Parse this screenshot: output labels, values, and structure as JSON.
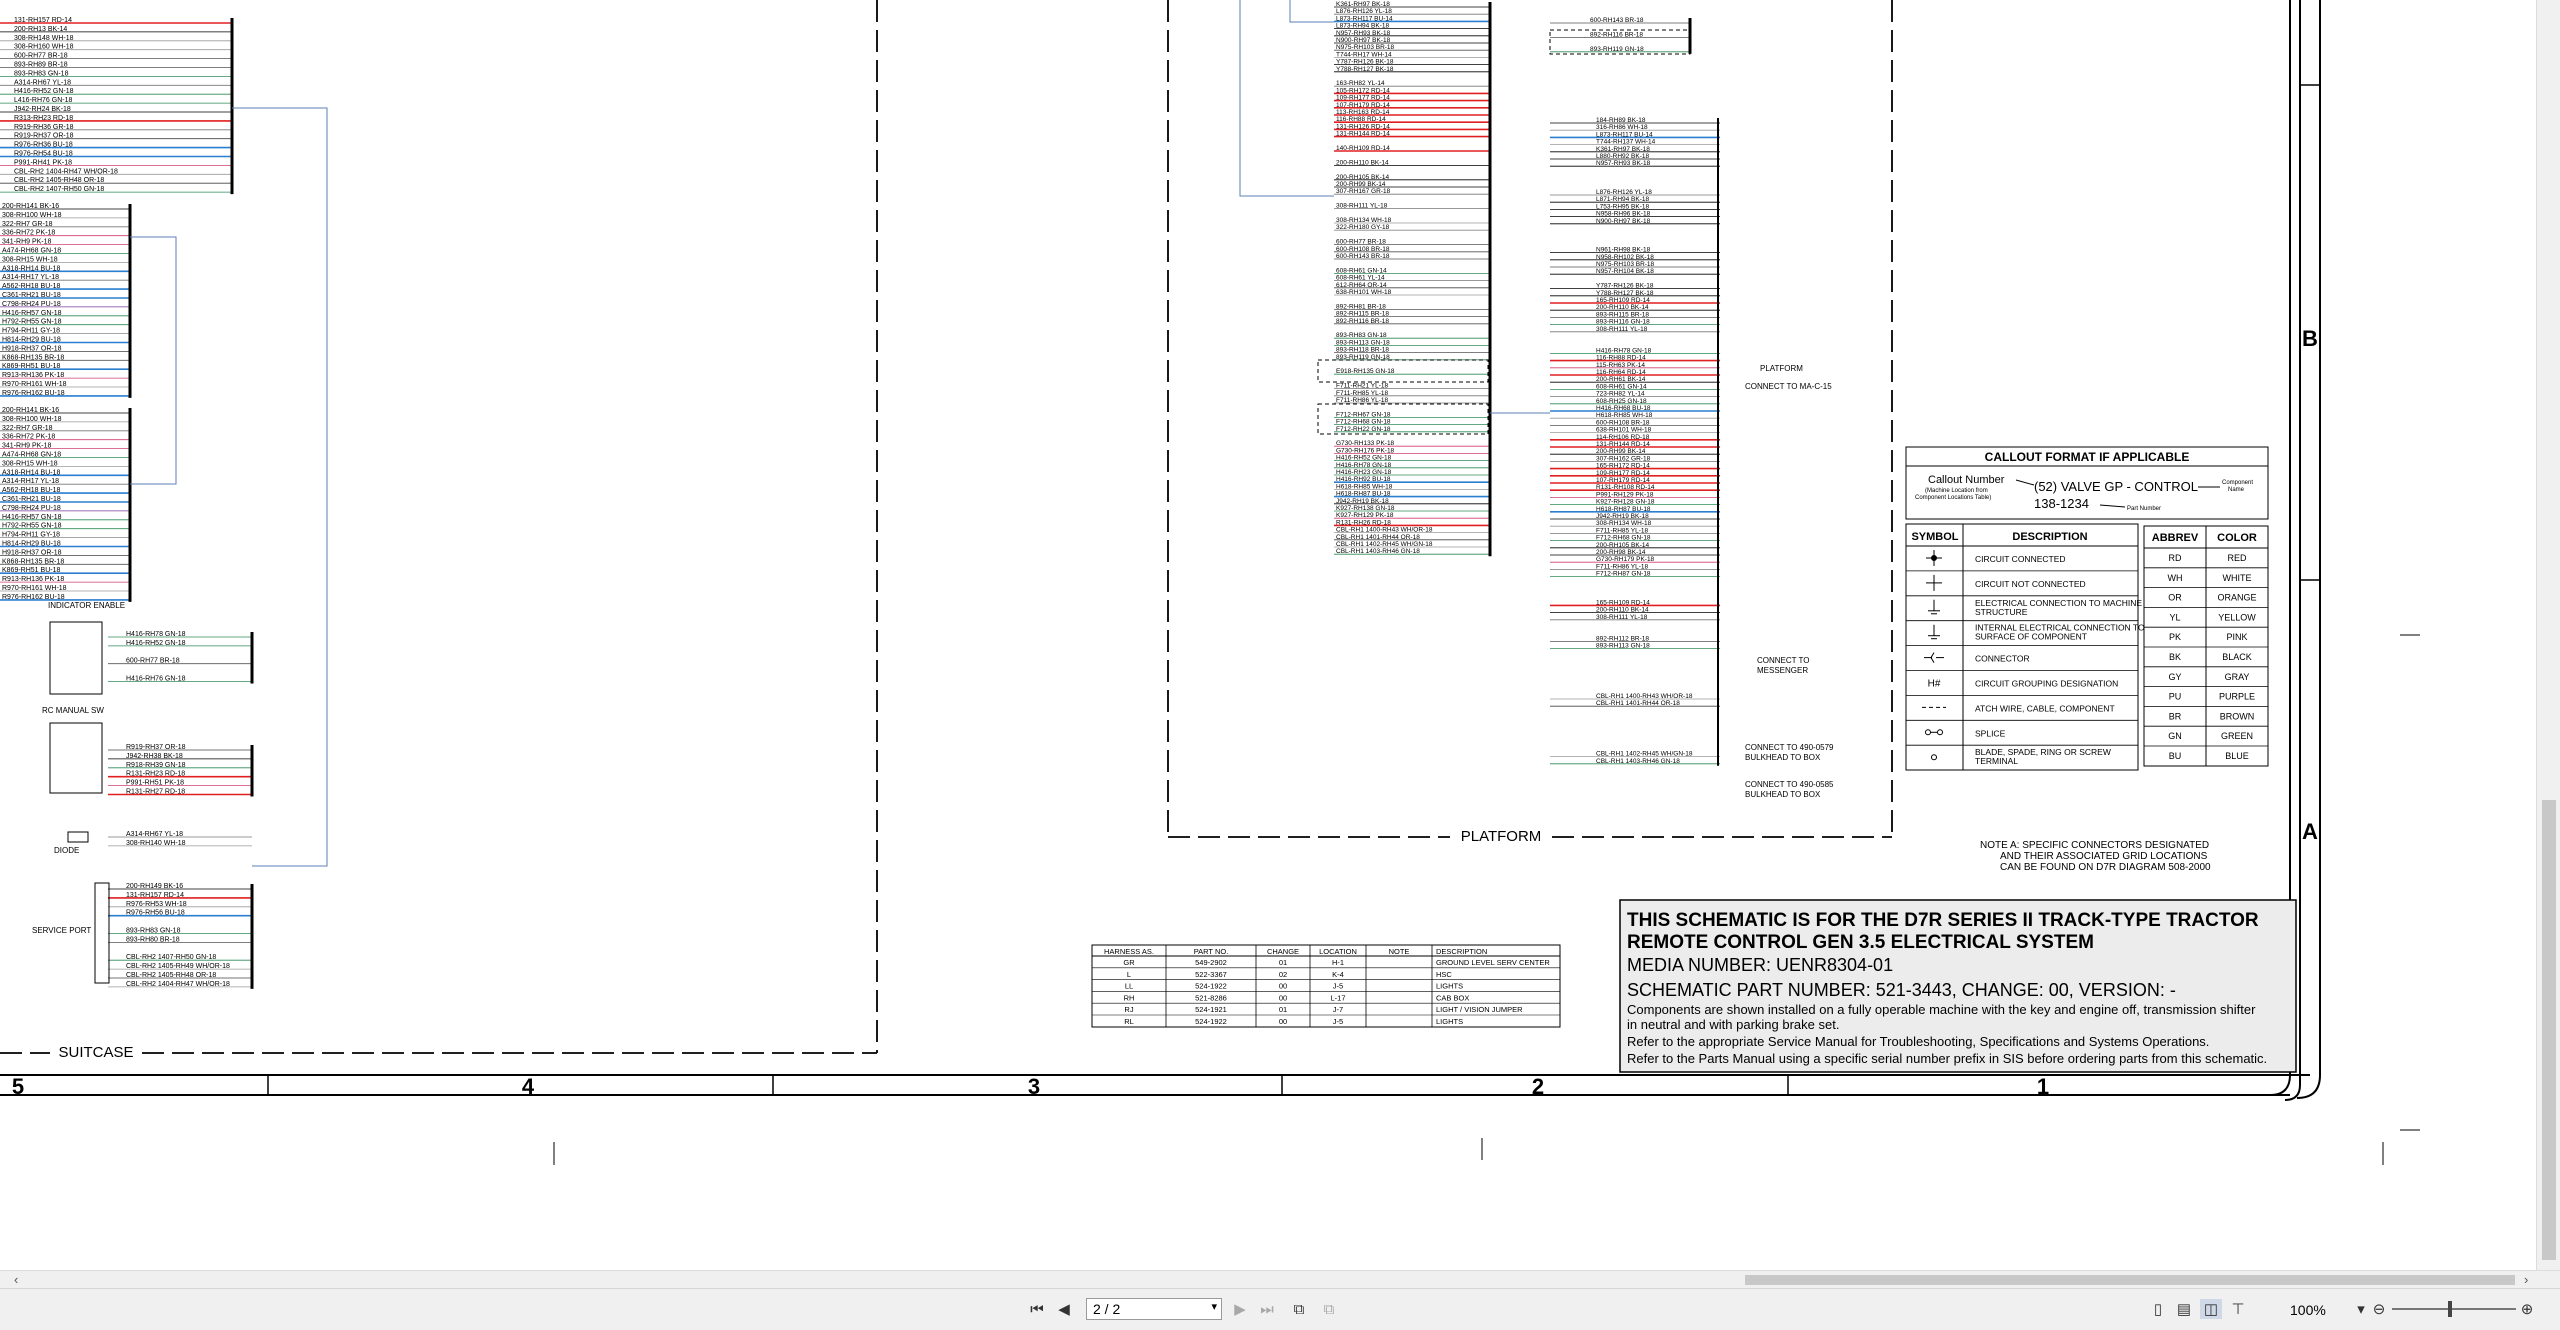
{
  "document": {
    "suitcase_label": "SUITCASE",
    "platform_label": "PLATFORM",
    "zone_columns": [
      "5",
      "4",
      "3",
      "2",
      "1"
    ],
    "zone_rows": [
      "B",
      "A"
    ],
    "platform_note": "PLATFORM",
    "connect_ma": "CONNECT TO MA-C-15",
    "connect_messenger": [
      "CONNECT TO",
      "MESSENGER"
    ],
    "connect_490_0579": [
      "CONNECT TO 490-0579",
      "BULKHEAD TO BOX"
    ],
    "connect_490_0585": [
      "CONNECT TO 490-0585",
      "BULKHEAD TO BOX"
    ],
    "indicator_enable": "INDICATOR ENABLE",
    "rc_manual_sw": "RC MANUAL SW",
    "diode": "DIODE",
    "service_port": "SERVICE PORT",
    "note_a": [
      "NOTE A: SPECIFIC CONNECTORS DESIGNATED",
      "AND THEIR ASSOCIATED GRID LOCATIONS",
      "CAN BE FOUND ON D7R DIAGRAM 508-2000"
    ]
  },
  "callout": {
    "title": "CALLOUT FORMAT IF APPLICABLE",
    "callout_number": "Callout Number",
    "machine_location": "(Machine Location from",
    "component_table": "Component Locations Table)",
    "example": "(52) VALVE GP - CONTROL",
    "part": "138-1234",
    "component_name": "Component",
    "component_name2": "Name",
    "part_number": "Part Number"
  },
  "symbol_table": {
    "headers": [
      "SYMBOL",
      "DESCRIPTION"
    ],
    "rows": [
      "CIRCUIT CONNECTED",
      "CIRCUIT NOT CONNECTED",
      "ELECTRICAL CONNECTION TO MACHINE STRUCTURE",
      "INTERNAL ELECTRICAL CONNECTION TO SURFACE OF COMPONENT",
      "CONNECTOR",
      "CIRCUIT GROUPING DESIGNATION",
      "ATCH WIRE, CABLE, COMPONENT",
      "SPLICE",
      "BLADE, SPADE, RING OR SCREW TERMINAL"
    ]
  },
  "color_table": {
    "headers": [
      "ABBREV",
      "COLOR"
    ],
    "rows": [
      [
        "RD",
        "RED"
      ],
      [
        "WH",
        "WHITE"
      ],
      [
        "OR",
        "ORANGE"
      ],
      [
        "YL",
        "YELLOW"
      ],
      [
        "PK",
        "PINK"
      ],
      [
        "BK",
        "BLACK"
      ],
      [
        "GY",
        "GRAY"
      ],
      [
        "PU",
        "PURPLE"
      ],
      [
        "BR",
        "BROWN"
      ],
      [
        "GN",
        "GREEN"
      ],
      [
        "BU",
        "BLUE"
      ]
    ]
  },
  "harness_table": {
    "headers": [
      "HARNESS AS.",
      "PART NO.",
      "CHANGE",
      "LOCATION",
      "NOTE",
      "DESCRIPTION"
    ],
    "rows": [
      [
        "GR",
        "549-2902",
        "01",
        "H-1",
        "",
        "GROUND LEVEL SERV CENTER"
      ],
      [
        "L",
        "522-3367",
        "02",
        "K-4",
        "",
        "HSC"
      ],
      [
        "LL",
        "524-1922",
        "00",
        "J-5",
        "",
        "LIGHTS"
      ],
      [
        "RH",
        "521-8286",
        "00",
        "L-17",
        "",
        "CAB BOX"
      ],
      [
        "RJ",
        "524-1921",
        "01",
        "J-7",
        "",
        "LIGHT / VISION JUMPER"
      ],
      [
        "RL",
        "524-1922",
        "00",
        "J-5",
        "",
        "LIGHTS"
      ]
    ]
  },
  "title_block": {
    "line1": "THIS SCHEMATIC IS FOR THE D7R SERIES II TRACK-TYPE TRACTOR",
    "line2": "REMOTE CONTROL GEN 3.5 ELECTRICAL SYSTEM",
    "media": "MEDIA NUMBER: UENR8304-01",
    "part": "SCHEMATIC PART NUMBER: 521-3443, CHANGE: 00, VERSION: -",
    "note1": "Components are shown installed on a fully operable machine with the key and engine off, transmission shifter",
    "note2": "in neutral and with parking brake set.",
    "note3": "Refer to the appropriate Service Manual for Troubleshooting, Specifications and Systems Operations.",
    "note4": "Refer to the Parts Manual using a specific serial number prefix in SIS before ordering parts from this schematic."
  },
  "wires": {
    "group1": [
      "131-RH157 RD-14",
      "200-RH13 BK-14",
      "308-RH148 WH-18",
      "308-RH160 WH-18",
      "600-RH77 BR-18",
      "893-RH89 BR-18",
      "893-RH83 GN-18",
      "A314-RH67 YL-18",
      "H416-RH52 GN-18",
      "L416-RH76 GN-18",
      "J942-RH24 BK-18",
      "R313-RH23 RD-18",
      "R919-RH36 GR-18",
      "R919-RH37 OR-18",
      "R976-RH36 BU-18",
      "R976-RH54 BU-18",
      "P991-RH41 PK-18",
      "CBL-RH2 1404-RH47 WH/OR-18",
      "CBL-RH2 1405-RH48 OR-18",
      "CBL-RH2 1407-RH50 GN-18"
    ],
    "group2": [
      "200-RH141 BK-16",
      "308-RH100 WH-18",
      "322-RH7 GR-18",
      "336-RH72 PK-18",
      "341-RH9 PK-18",
      "A474-RH68 GN-18",
      "308-RH15 WH-18",
      "A318-RH14 BU-18",
      "A314-RH17 YL-18",
      "A562-RH18 BU-18",
      "C361-RH21 BU-18",
      "C798-RH24 PU-18",
      "H416-RH57 GN-18",
      "H792-RH55 GN-18",
      "H794-RH11 GY-18",
      "H814-RH29 BU-18",
      "H918-RH37 OR-18",
      "K868-RH135 BR-18",
      "K869-RH51 BU-18",
      "R913-RH136 PK-18",
      "R970-RH161 WH-18",
      "R976-RH162 BU-18"
    ],
    "group3": [
      "200-RH141 BK-16",
      "308-RH100 WH-18",
      "322-RH7 GR-18",
      "336-RH72 PK-18",
      "341-RH9 PK-18",
      "A474-RH68 GN-18",
      "308-RH15 WH-18",
      "A318-RH14 BU-18",
      "A314-RH17 YL-18",
      "A562-RH18 BU-18",
      "C361-RH21 BU-18",
      "C798-RH24 PU-18",
      "H416-RH57 GN-18",
      "H792-RH55 GN-18",
      "H794-RH11 GY-18",
      "H814-RH29 BU-18",
      "H918-RH37 OR-18",
      "K868-RH135 BR-18",
      "K869-RH51 BU-18",
      "R913-RH136 PK-18",
      "R970-RH161 WH-18",
      "R976-RH162 BU-18"
    ],
    "indicator": [
      "H416-RH78 GN-18",
      "H416-RH52 GN-18",
      "",
      "600-RH77 BR-18",
      "",
      "H416-RH76 GN-18"
    ],
    "rcmanual": [
      "R919-RH37 OR-18",
      "J942-RH38 BK-18",
      "R918-RH39 GN-18",
      "R131-RH23 RD-18",
      "P991-RH51 PK-18",
      "R131-RH27 RD-18"
    ],
    "diode": [
      "A314-RH67 YL-18",
      "308-RH140 WH-18"
    ],
    "service": [
      "200-RH149 BK-16",
      "131-RH157 RD-14",
      "R976-RH53 WH-18",
      "R976-RH56 BU-18",
      "",
      "893-RH83 GN-18",
      "893-RH80 BR-18",
      "",
      "CBL-RH2 1407-RH50 GN-18",
      "CBL-RH2 1405-RH49 WH/OR-18",
      "CBL-RH2 1405-RH48 OR-18",
      "CBL-RH2 1404-RH47 WH/OR-18"
    ],
    "mid": [
      "K361-RH97 BK-18",
      "L876-RH126 YL-18",
      "L873-RH117 BU-14",
      "L873-RH94 BK-18",
      "N957-RH93 BK-18",
      "N900-RH97 BK-18",
      "N975-RH103 BR-18",
      "T744-RH17 WH-14",
      "Y787-RH126 BK-18",
      "Y788-RH127 BK-18",
      "",
      "163-RH82 YL-14",
      "105-RH172 RD-14",
      "109-RH177 RD-14",
      "107-RH179 RD-14",
      "113-RH163 RD-14",
      "116-RH88 RD-14",
      "131-RH126 RD-14",
      "131-RH144 RD-14",
      "",
      "140-RH109 RD-14",
      "",
      "200-RH110 BK-14",
      "",
      "200-RH105 BK-14",
      "200-RH99 BK-14",
      "307-RH167 GR-18",
      "",
      "308-RH111 YL-18",
      "",
      "308-RH134 WH-18",
      "322-RH180 GY-18",
      "",
      "600-RH77 BR-18",
      "600-RH108 BR-18",
      "600-RH143 BR-18",
      "",
      "608-RH61 GN-14",
      "608-RH61 YL-14",
      "612-RH64 OR-14",
      "638-RH101 WH-18",
      "",
      "892-RH81 BR-18",
      "892-RH115 BR-18",
      "892-RH116 BR-18",
      "",
      "893-RH83 GN-18",
      "893-RH113 GN-18",
      "893-RH118 BR-18",
      "893-RH119 GN-18",
      "",
      "E918-RH135 GN-18",
      "",
      "F711-RH21 YL-18",
      "F711-RH85 YL-18",
      "F711-RH86 YL-18",
      "",
      "F712-RH67 GN-18",
      "F712-RH68 GN-18",
      "F712-RH22 GN-18",
      "",
      "G730-RH133 PK-18",
      "G730-RH176 PK-18",
      "H416-RH52 GN-18",
      "H416-RH78 GN-18",
      "H416-RH23 GN-18",
      "H416-RH92 BU-18",
      "H618-RH85 WH-18",
      "H618-RH87 BU-18",
      "J942-RH19 BK-18",
      "K927-RH138 GN-18",
      "K927-RH129 PK-18",
      "R131-RH26 RD-18",
      "CBL-RH1 1400-RH43 WH/OR-18",
      "CBL-RH1 1401-RH44 OR-18",
      "CBL-RH1 1402-RH45 WH/GN-18",
      "CBL-RH1 1403-RH46 GN-18"
    ],
    "right_top": [
      "600-RH143 BR-18",
      "",
      "892-RH116 BR-18",
      "",
      "893-RH119 GN-18"
    ],
    "right": [
      "184-RH89 BK-18",
      "316-RH86 WH-18",
      "L873-RH117 BU-14",
      "T744-RH137 WH-14",
      "K361-RH97 BK-18",
      "L880-RH92 BK-18",
      "N957-RH93 BK-18",
      "",
      "",
      "",
      "L876-RH126 YL-18",
      "L871-RH94 BK-18",
      "L753-RH95 BK-18",
      "N958-RH96 BK-18",
      "N900-RH97 BK-18",
      "",
      "",
      "",
      "N961-RH98 BK-18",
      "N958-RH102 BK-18",
      "N975-RH103 BR-18",
      "N957-RH104 BK-18",
      "",
      "Y787-RH126 BK-18",
      "Y788-RH127 BK-18",
      "165-RH109 RD-14",
      "200-RH110 BK-14",
      "893-RH115 BR-18",
      "893-RH116 GN-18",
      "308-RH111 YL-18",
      "",
      "",
      "H416-RH78 GN-18",
      "116-RH88 RD-14",
      "115-RH63 PK-14",
      "116-RH64 RD-14",
      "200-RH61 BK-14",
      "608-RH61 GN-14",
      "723-RH82 YL-14",
      "608-RH25 GN-18",
      "H416-RH68 BU-18",
      "H618-RH85 WH-18",
      "600-RH108 BR-18",
      "638-RH101 WH-18",
      "114-RH106 RD-18",
      "131-RH144 RD-14",
      "200-RH99 BK-14",
      "307-RH162 GR-18",
      "165-RH172 RD-14",
      "109-RH177 RD-14",
      "107-RH179 RD-14",
      "R131-RH108 RD-14",
      "P991-RH129 PK-18",
      "K927-RH128 GN-18",
      "H618-RH87 BU-18",
      "J942-RH19 BK-18",
      "308-RH134 WH-18",
      "F711-RH85 YL-18",
      "F712-RH68 GN-18",
      "200-RH105 BK-14",
      "200-RH98 BK-14",
      "G730-RH179 PK-18",
      "F711-RH86 YL-18",
      "F712-RH87 GN-18",
      "",
      "",
      "",
      "165-RH109 RD-14",
      "200-RH110 BK-14",
      "308-RH111 YL-18",
      "",
      "",
      "892-RH112 BR-18",
      "893-RH113 GN-18",
      "",
      "",
      "",
      "",
      "",
      "",
      "CBL-RH1 1400-RH43 WH/OR-18",
      "CBL-RH1 1401-RH44 OR-18",
      "",
      "",
      "",
      "",
      "",
      "",
      "CBL-RH1 1402-RH45 WH/GN-18",
      "CBL-RH1 1403-RH46 GN-18"
    ]
  },
  "status": {
    "page_value": "2 / 2",
    "zoom": "100%"
  }
}
